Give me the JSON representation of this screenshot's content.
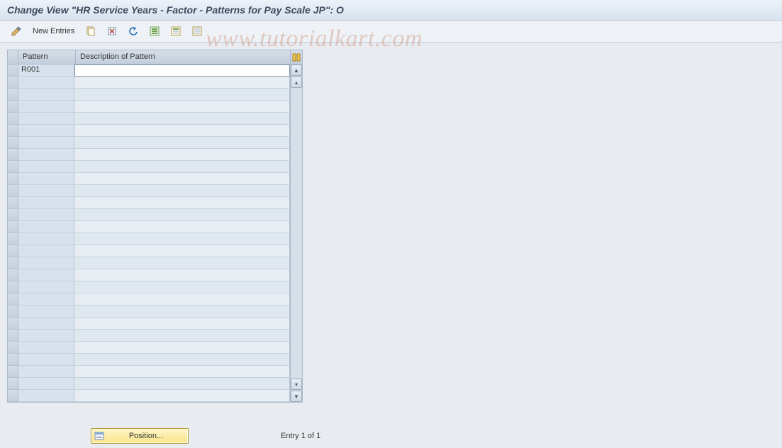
{
  "title": "Change View \"HR Service Years - Factor - Patterns for Pay Scale JP\": O",
  "toolbar": {
    "new_entries_label": "New Entries",
    "icons": {
      "change": "change-mode-icon",
      "copy": "copy-icon",
      "delete": "delete-icon",
      "undo": "undo-icon",
      "select_all": "select-all-icon",
      "select_block": "select-block-icon",
      "deselect": "deselect-icon"
    }
  },
  "grid": {
    "columns": {
      "pattern": "Pattern",
      "description": "Description of Pattern"
    },
    "rows": [
      {
        "pattern": "R001",
        "description": ""
      }
    ],
    "empty_row_count": 27
  },
  "footer": {
    "position_label": "Position...",
    "entry_text": "Entry 1 of 1"
  },
  "watermark": "www.tutorialkart.com"
}
